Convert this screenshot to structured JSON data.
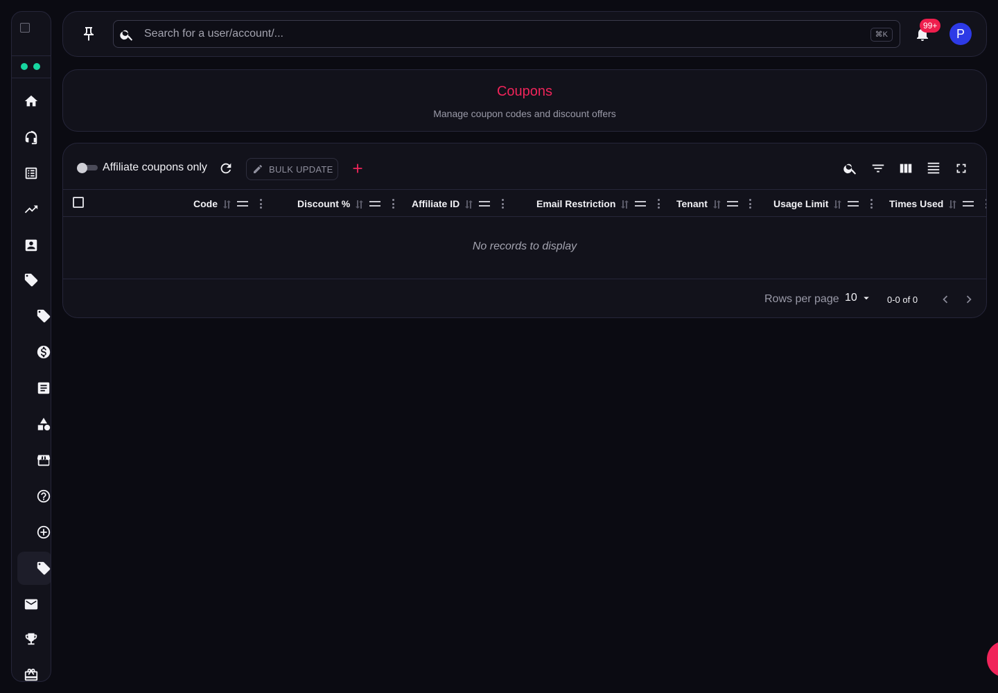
{
  "topbar": {
    "search_placeholder": "Search for a user/account/...",
    "shortcut": "⌘K",
    "notifications_badge": "99+",
    "avatar_initial": "P"
  },
  "header": {
    "title": "Coupons",
    "subtitle": "Manage coupon codes and discount offers"
  },
  "toolbar": {
    "toggle_label": "Affiliate coupons only",
    "toggle_on": false,
    "bulk_update_label": "BULK UPDATE"
  },
  "table": {
    "columns": [
      "Code",
      "Discount %",
      "Affiliate ID",
      "Email Restriction",
      "Tenant",
      "Usage Limit",
      "Times Used"
    ],
    "empty_message": "No records to display"
  },
  "pagination": {
    "rows_per_page_label": "Rows per page",
    "rows_per_page": "10",
    "range": "0-0 of 0"
  },
  "colors": {
    "accent": "#f0245a",
    "status_dot": "#17d6a0",
    "avatar": "#2d3ae6",
    "badge": "#ee1e4d"
  }
}
